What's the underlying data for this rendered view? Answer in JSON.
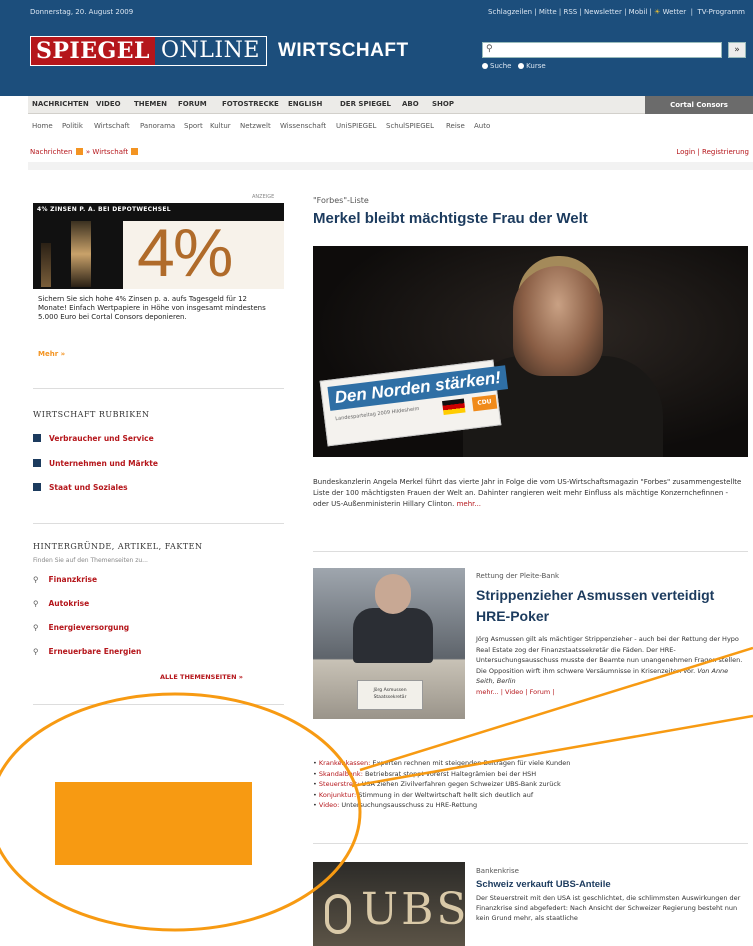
{
  "header": {
    "date": "Donnerstag, 20. August 2009",
    "toplinks": "Schlagzeilen | Mitte | RSS | Newsletter | Mobil |",
    "weather": "Wetter",
    "tvprogramm": "TV-Programm",
    "logo_red": "SPIEGEL",
    "logo_rest": "ONLINE",
    "section": "WIRTSCHAFT",
    "search_placeholder": "",
    "search_button": "»",
    "radio_suche": "Suche",
    "radio_kurse": "Kurse"
  },
  "nav": {
    "items": [
      "NACHRICHTEN",
      "VIDEO",
      "THEMEN",
      "FORUM",
      "FOTOSTRECKE",
      "ENGLISH",
      "DER SPIEGEL",
      "ABO",
      "SHOP"
    ],
    "cortal": "Cortal Consors"
  },
  "subnav": {
    "items": [
      "Home",
      "Politik",
      "Wirtschaft",
      "Panorama",
      "Sport",
      "Kultur",
      "Netzwelt",
      "Wissenschaft",
      "UniSPIEGEL",
      "SchulSPIEGEL",
      "Reise",
      "Auto"
    ]
  },
  "breadcrumb": {
    "first": "Nachrichten",
    "arrow": "»",
    "second": "Wirtschaft"
  },
  "login": "Login | Registrierung",
  "ad": {
    "label": "ANZEIGE",
    "headline": "4% ZINSEN P. A. BEI DEPOTWECHSEL",
    "percent": "4%",
    "text": "Sichern Sie sich hohe 4% Zinsen p. a. aufs Tagesgeld für 12 Monate! Einfach Wertpapiere in Höhe von insgesamt mindestens 5.000 Euro bei Cortal Consors deponieren.",
    "more": "Mehr »"
  },
  "rubriken": {
    "title": "WIRTSCHAFT RUBRIKEN",
    "items": [
      "Verbraucher und Service",
      "Unternehmen und Märkte",
      "Staat und Soziales"
    ]
  },
  "hintergruende": {
    "title": "HINTERGRÜNDE, ARTIKEL, FAKTEN",
    "subtitle": "Finden Sie auf den Themenseiten zu...",
    "items": [
      "Finanzkrise",
      "Autokrise",
      "Energieversorgung",
      "Erneuerbare Energien"
    ],
    "all": "ALLE THEMENSEITEN »"
  },
  "lead_story": {
    "kicker": "\"Forbes\"-Liste",
    "headline": "Merkel bleibt mächtigste Frau der Welt",
    "photo_sign": "Den Norden stärken!",
    "photo_sign_sub": "Landesparteitag 2009 Hildesheim",
    "photo_party": "CDU",
    "text": "Bundeskanzlerin Angela Merkel führt das vierte Jahr in Folge die vom US-Wirtschaftsmagazin \"Forbes\" zusammengestellte Liste der 100 mächtigsten Frauen der Welt an. Dahinter rangieren weit mehr Einfluss als mächtige Konzernchefinnen - oder US-Außenministerin Hillary Clinton.",
    "more": "mehr..."
  },
  "story2": {
    "kicker": "Rettung der Pleite-Bank",
    "headline": "Strippenzieher Asmussen verteidigt HRE-Poker",
    "nameplate": "Jörg Asmussen Staatssekretär",
    "text": "Jörg Asmussen gilt als mächtiger Strippenzieher - auch bei der Rettung der Hypo Real Estate zog der Finanzstaatssekretär die Fäden. Der HRE-Untersuchungsausschuss musste der Beamte nun unangenehmen Fragen stellen. Die Opposition wirft ihm schwere Versäumnisse in Krisenzeiten vor.",
    "byline": "Von Anne Seith, Berlin",
    "links": "mehr... | Video | Forum |"
  },
  "teasers": [
    {
      "lead": "Krankenkassen:",
      "text": "Experten rechnen mit steigenden Beiträgen für viele Kunden"
    },
    {
      "lead": "Skandalbank:",
      "text": "Betriebsrat stoppt vorerst Haltegrämien bei der HSH"
    },
    {
      "lead": "Steuerstreit:",
      "text": "USA ziehen Zivilverfahren gegen Schweizer UBS-Bank zurück"
    },
    {
      "lead": "Konjunktur:",
      "text": "Stimmung in der Weltwirtschaft hellt sich deutlich auf"
    },
    {
      "lead": "Video:",
      "text": "Untersuchungsausschuss zu HRE-Rettung"
    }
  ],
  "story3": {
    "kicker": "Bankenkrise",
    "headline": "Schweiz verkauft UBS-Anteile",
    "photo_text": "UBS",
    "text": "Der Steuerstreit mit den USA ist geschlichtet, die schlimmsten Auswirkungen der Finanzkrise sind abgefedert: Nach Ansicht der Schweizer Regierung besteht nun kein Grund mehr, als staatliche"
  },
  "colors": {
    "brand_blue": "#1c4e7c",
    "brand_red": "#b5161b",
    "annotation_orange": "#f79a12"
  }
}
